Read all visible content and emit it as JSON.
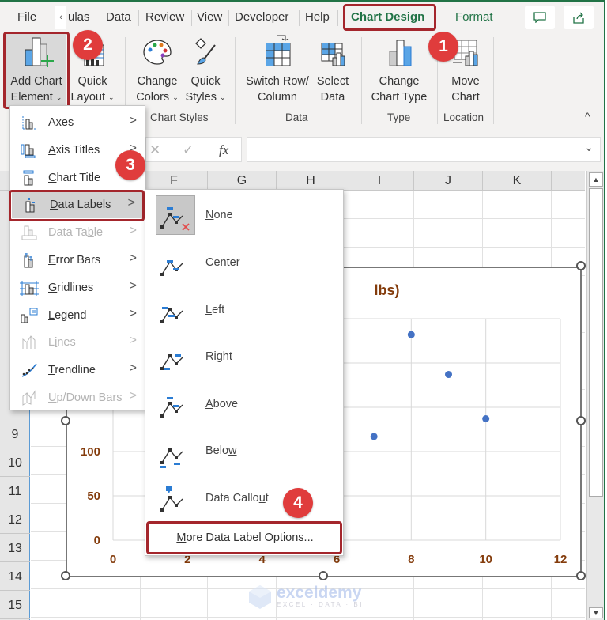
{
  "ribbon": {
    "tabs": [
      {
        "label": "File"
      },
      {
        "label": "ulas"
      },
      {
        "label": "Data"
      },
      {
        "label": "Review"
      },
      {
        "label": "View"
      },
      {
        "label": "Developer"
      },
      {
        "label": "Help"
      },
      {
        "label": "Chart Design",
        "active": true
      },
      {
        "label": "Format"
      }
    ],
    "tab_scroll_glyph": "‹",
    "buttons": {
      "add_chart_element": {
        "line1": "Add Chart",
        "line2": "Element"
      },
      "quick_layout": {
        "line1": "Quick",
        "line2": "Layout"
      },
      "change_colors": {
        "line1": "Change",
        "line2": "Colors"
      },
      "quick_styles": {
        "line1": "Quick",
        "line2": "Styles"
      },
      "switch_row_column": {
        "line1": "Switch Row/",
        "line2": "Column"
      },
      "select_data": {
        "line1": "Select",
        "line2": "Data"
      },
      "change_chart_type": {
        "line1": "Change",
        "line2": "Chart Type"
      },
      "move_chart": {
        "line1": "Move",
        "line2": "Chart"
      }
    },
    "groups": {
      "chart_styles": "Chart Styles",
      "data": "Data",
      "type": "Type",
      "location": "Location"
    },
    "collapse_glyph": "^"
  },
  "formula_bar": {
    "cancel_glyph": "✕",
    "enter_glyph": "✓",
    "fx_label": "fx",
    "value": "",
    "expand_glyph": "⌄"
  },
  "grid": {
    "columns": [
      "F",
      "G",
      "H",
      "I",
      "J",
      "K"
    ],
    "rows": [
      "9",
      "10",
      "11",
      "12",
      "13",
      "14",
      "15"
    ]
  },
  "add_chart_element_menu": {
    "items": [
      {
        "label": "Axes",
        "underline": "x",
        "enabled": true
      },
      {
        "label": "Axis Titles",
        "underline": "A",
        "enabled": true
      },
      {
        "label": "Chart Title",
        "underline": "C",
        "enabled": true
      },
      {
        "label": "Data Labels",
        "underline": "D",
        "enabled": true,
        "selected": true
      },
      {
        "label": "Data Table",
        "underline": "b",
        "enabled": false
      },
      {
        "label": "Error Bars",
        "underline": "E",
        "enabled": true
      },
      {
        "label": "Gridlines",
        "underline": "G",
        "enabled": true
      },
      {
        "label": "Legend",
        "underline": "L",
        "enabled": true
      },
      {
        "label": "Lines",
        "underline": "i",
        "enabled": false
      },
      {
        "label": "Trendline",
        "underline": "T",
        "enabled": true
      },
      {
        "label": "Up/Down Bars",
        "underline": "U",
        "enabled": false
      }
    ],
    "chevron_glyph": ">"
  },
  "data_labels_submenu": {
    "items": [
      {
        "label": "None",
        "selected": true
      },
      {
        "label": "Center"
      },
      {
        "label": "Left"
      },
      {
        "label": "Right"
      },
      {
        "label": "Above"
      },
      {
        "label": "Below"
      },
      {
        "label": "Data Callout"
      }
    ],
    "more_options": "More Data Label Options..."
  },
  "annotations": {
    "step1": "1",
    "step2": "2",
    "step3": "3",
    "step4": "4",
    "highlight_color": "#a4262c",
    "badge_color": "#e03c3c"
  },
  "chart_data": {
    "type": "scatter",
    "title_visible_fragment": "lbs)",
    "x": [
      7,
      8,
      9,
      10
    ],
    "y": [
      117,
      232,
      187,
      137
    ],
    "xlim": [
      0,
      12
    ],
    "ylim": [
      0,
      250
    ],
    "x_ticks": [
      0,
      2,
      4,
      6,
      8,
      10,
      12
    ],
    "y_ticks": [
      0,
      50,
      100,
      150,
      200,
      250
    ],
    "y_tick_labels_visible": [
      "0",
      "50",
      "100"
    ],
    "grid": true,
    "marker_color": "#4472c4",
    "label_color": "#843c0c"
  },
  "watermark": {
    "name": "exceldemy",
    "tagline": "EXCEL · DATA · BI"
  }
}
